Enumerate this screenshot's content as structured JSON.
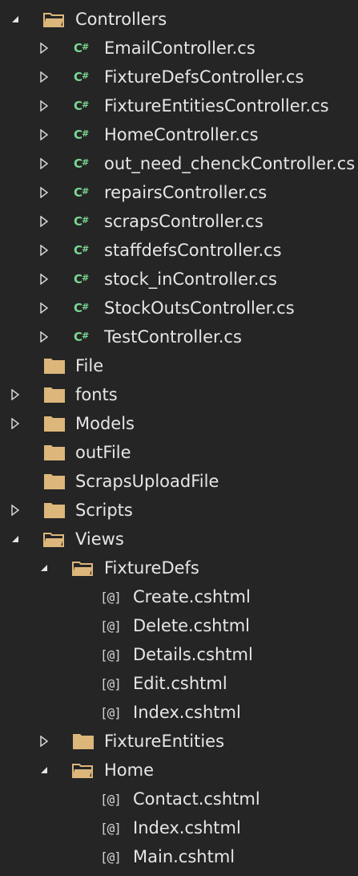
{
  "solution_explorer": {
    "controllers": {
      "label": "Controllers",
      "files": [
        "EmailController.cs",
        "FixtureDefsController.cs",
        "FixtureEntitiesController.cs",
        "HomeController.cs",
        "out_need_chenckController.cs",
        "repairsController.cs",
        "scrapsController.cs",
        "staffdefsController.cs",
        "stock_inController.cs",
        "StockOutsController.cs",
        "TestController.cs"
      ]
    },
    "folders": {
      "file": "File",
      "fonts": "fonts",
      "models": "Models",
      "outfile": "outFile",
      "scrapsuploadfile": "ScrapsUploadFile",
      "scripts": "Scripts"
    },
    "views": {
      "label": "Views",
      "fixturedefs": {
        "label": "FixtureDefs",
        "files": [
          "Create.cshtml",
          "Delete.cshtml",
          "Details.cshtml",
          "Edit.cshtml",
          "Index.cshtml"
        ]
      },
      "fixtureentities": {
        "label": "FixtureEntities"
      },
      "home": {
        "label": "Home",
        "files": [
          "Contact.cshtml",
          "Index.cshtml",
          "Main.cshtml"
        ]
      }
    },
    "icons": {
      "cs_prefix": "C",
      "cs_suffix": "#",
      "razor_glyph": "[@]"
    },
    "colors": {
      "background": "#252526",
      "text": "#e6e6e6",
      "folder": "#dcb67a",
      "csharp_icon": "#7bd88f",
      "arrow": "#d4d4d4"
    }
  }
}
